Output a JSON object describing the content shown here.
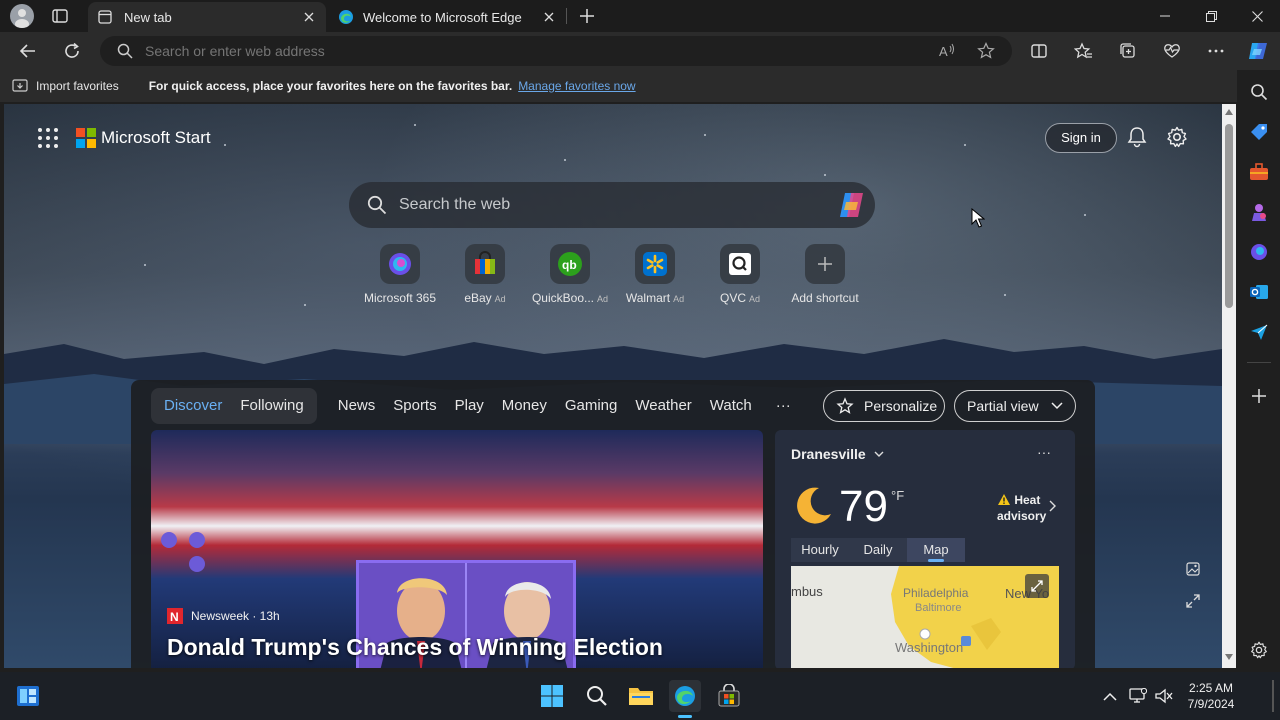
{
  "tabs": [
    {
      "title": "New tab",
      "active": true
    },
    {
      "title": "Welcome to Microsoft Edge",
      "active": false
    }
  ],
  "address_bar": {
    "placeholder": "Search or enter web address"
  },
  "favorites_bar": {
    "import_label": "Import favorites",
    "message": "For quick access, place your favorites here on the favorites bar.",
    "link": "Manage favorites now"
  },
  "start": {
    "brand": "Microsoft Start",
    "sign_in": "Sign in",
    "search_placeholder": "Search the web"
  },
  "shortcuts": [
    {
      "label": "Microsoft 365",
      "ad": ""
    },
    {
      "label": "eBay",
      "ad": "Ad"
    },
    {
      "label": "QuickBoo...",
      "ad": "Ad"
    },
    {
      "label": "Walmart",
      "ad": "Ad"
    },
    {
      "label": "QVC",
      "ad": "Ad"
    },
    {
      "label": "Add shortcut",
      "ad": ""
    }
  ],
  "feed": {
    "tabs_group": [
      "Discover",
      "Following"
    ],
    "tabs": [
      "News",
      "Sports",
      "Play",
      "Money",
      "Gaming",
      "Weather",
      "Watch"
    ],
    "more": "···",
    "personalize": "Personalize",
    "partial_view": "Partial view"
  },
  "hero": {
    "source": "Newsweek · 13h",
    "title": "Donald Trump's Chances of Winning Election"
  },
  "weather": {
    "location": "Dranesville",
    "more": "···",
    "temperature": "79",
    "unit": "°F",
    "alert_line1": "Heat",
    "alert_line2": "advisory",
    "tabs": [
      "Hourly",
      "Daily",
      "Map"
    ],
    "selected_tab": "Map",
    "map_labels": [
      "mbus",
      "Philadelphia",
      "Baltimore",
      "New Yo",
      "Washington"
    ]
  },
  "taskbar": {
    "time": "2:25 AM",
    "date": "7/9/2024"
  },
  "colors": {
    "accent": "#6ab0f3",
    "link": "#6aa7e8",
    "map_alert": "#f2d24a"
  }
}
